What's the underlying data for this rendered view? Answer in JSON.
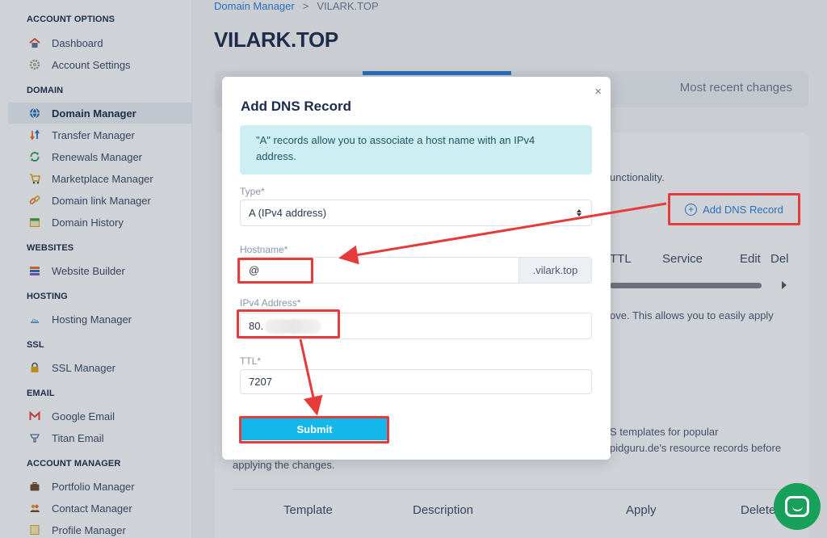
{
  "sidebar": {
    "sections": [
      {
        "label": "ACCOUNT OPTIONS",
        "items": [
          {
            "label": "Dashboard",
            "icon": "home-icon"
          },
          {
            "label": "Account Settings",
            "icon": "gear-icon"
          }
        ]
      },
      {
        "label": "DOMAIN",
        "items": [
          {
            "label": "Domain Manager",
            "icon": "globe-icon",
            "active": true
          },
          {
            "label": "Transfer Manager",
            "icon": "transfer-icon"
          },
          {
            "label": "Renewals Manager",
            "icon": "refresh-icon"
          },
          {
            "label": "Marketplace Manager",
            "icon": "cart-icon"
          },
          {
            "label": "Domain link Manager",
            "icon": "link-icon"
          },
          {
            "label": "Domain History",
            "icon": "calendar-icon"
          }
        ]
      },
      {
        "label": "WEBSITES",
        "items": [
          {
            "label": "Website Builder",
            "icon": "layers-icon"
          }
        ]
      },
      {
        "label": "HOSTING",
        "items": [
          {
            "label": "Hosting Manager",
            "icon": "cloud-icon"
          }
        ]
      },
      {
        "label": "SSL",
        "items": [
          {
            "label": "SSL Manager",
            "icon": "lock-icon"
          }
        ]
      },
      {
        "label": "EMAIL",
        "items": [
          {
            "label": "Google Email",
            "icon": "gmail-icon"
          },
          {
            "label": "Titan Email",
            "icon": "titan-icon"
          }
        ]
      },
      {
        "label": "ACCOUNT MANAGER",
        "items": [
          {
            "label": "Portfolio Manager",
            "icon": "briefcase-icon"
          },
          {
            "label": "Contact Manager",
            "icon": "contacts-icon"
          },
          {
            "label": "Profile Manager",
            "icon": "profile-icon"
          }
        ]
      }
    ]
  },
  "breadcrumb": {
    "link": "Domain Manager",
    "separator": ">",
    "current": "VILARK.TOP"
  },
  "page_title": "VILARK.TOP",
  "tabs": {
    "recent_label": "Most recent changes"
  },
  "background": {
    "functionality_text": "unctionality.",
    "add_dns_label": "Add DNS Record",
    "columns": [
      "TTL",
      "Service",
      "Edit",
      "Del"
    ],
    "apply_text": "ove. This allows you to easily apply",
    "templates_line1": "S templates for popular",
    "templates_line2": "pidguru.de's resource records before",
    "templates_line3": "applying the changes.",
    "template_columns": [
      "Template",
      "Description",
      "Apply",
      "Delete"
    ]
  },
  "modal": {
    "title": "Add DNS Record",
    "close": "×",
    "info": "\"A\" records allow you to associate a host name with an IPv4 address.",
    "type_label": "Type*",
    "type_value": "A (IPv4 address)",
    "hostname_label": "Hostname*",
    "hostname_value": "@",
    "hostname_suffix": ".vilark.top",
    "ipv4_label": "IPv4 Address*",
    "ipv4_value": "80.",
    "ttl_label": "TTL*",
    "ttl_value": "7207",
    "submit_label": "Submit"
  },
  "colors": {
    "accent": "#2a7bd6",
    "highlight": "#e53b3b",
    "submit": "#14b7ea",
    "chat": "#17a05a"
  }
}
